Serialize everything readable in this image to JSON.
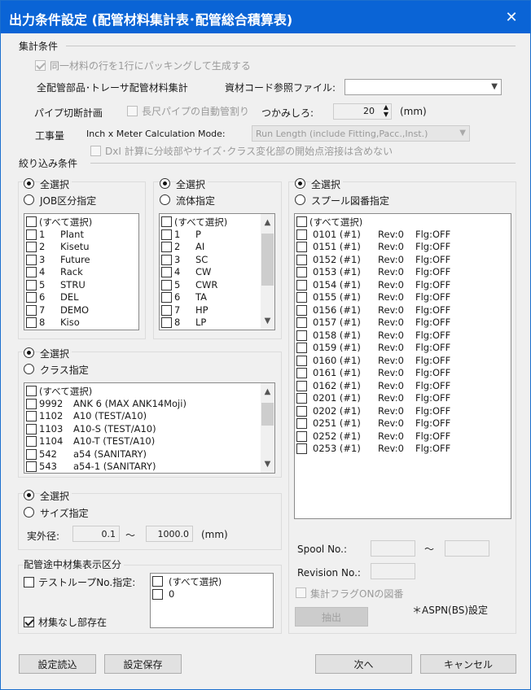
{
  "window": {
    "title": "出力条件設定 (配管材料集計表･配管総合積算表)",
    "close_glyph": "✕"
  },
  "aggregate": {
    "header": "集計条件",
    "same_material_label": "同一材料の行を1行にパッキングして生成する",
    "same_material_checked": true,
    "all_parts_label": "全配管部品･トレーサ配管材料集計",
    "material_code_file_label": "資材コード参照ファイル:",
    "material_code_file_value": "",
    "pipe_cut_label": "パイプ切断計画",
    "long_pipe_label": "長尺パイプの自動管割り",
    "long_pipe_checked": false,
    "grip_label": "つかみしろ:",
    "grip_value": "20",
    "grip_unit": "(mm)",
    "work_amount_label": "工事量",
    "calc_mode_label": "Inch x Meter Calculation Mode:",
    "calc_mode_value": "Run Length (include Fitting,Pacc.,Inst.)",
    "dxi_label": "DxI 計算に分岐部やサイズ･クラス変化部の開始点溶接は含めない",
    "dxi_checked": false
  },
  "filter": {
    "header": "絞り込み条件"
  },
  "job": {
    "all_label": "全選択",
    "specify_label": "JOB区分指定",
    "items": [
      {
        "no": "",
        "name": "(すべて選択)"
      },
      {
        "no": "1",
        "name": "Plant"
      },
      {
        "no": "2",
        "name": "Kisetu"
      },
      {
        "no": "3",
        "name": "Future"
      },
      {
        "no": "4",
        "name": "Rack"
      },
      {
        "no": "5",
        "name": "STRU"
      },
      {
        "no": "6",
        "name": "DEL"
      },
      {
        "no": "7",
        "name": "DEMO"
      },
      {
        "no": "8",
        "name": "Kiso"
      }
    ]
  },
  "fluid": {
    "all_label": "全選択",
    "specify_label": "流体指定",
    "items": [
      {
        "no": "",
        "name": "(すべて選択)"
      },
      {
        "no": "1",
        "name": "P"
      },
      {
        "no": "2",
        "name": "AI"
      },
      {
        "no": "3",
        "name": "SC"
      },
      {
        "no": "4",
        "name": "CW"
      },
      {
        "no": "5",
        "name": "CWR"
      },
      {
        "no": "6",
        "name": "TA"
      },
      {
        "no": "7",
        "name": "HP"
      },
      {
        "no": "8",
        "name": "LP"
      }
    ]
  },
  "spool": {
    "all_label": "全選択",
    "specify_label": "スプール図番指定",
    "select_all": "(すべて選択)",
    "items": [
      {
        "no": "0101 (#1)",
        "rev": "Rev:0",
        "flg": "Flg:OFF"
      },
      {
        "no": "0151 (#1)",
        "rev": "Rev:0",
        "flg": "Flg:OFF"
      },
      {
        "no": "0152 (#1)",
        "rev": "Rev:0",
        "flg": "Flg:OFF"
      },
      {
        "no": "0153 (#1)",
        "rev": "Rev:0",
        "flg": "Flg:OFF"
      },
      {
        "no": "0154 (#1)",
        "rev": "Rev:0",
        "flg": "Flg:OFF"
      },
      {
        "no": "0155 (#1)",
        "rev": "Rev:0",
        "flg": "Flg:OFF"
      },
      {
        "no": "0156 (#1)",
        "rev": "Rev:0",
        "flg": "Flg:OFF"
      },
      {
        "no": "0157 (#1)",
        "rev": "Rev:0",
        "flg": "Flg:OFF"
      },
      {
        "no": "0158 (#1)",
        "rev": "Rev:0",
        "flg": "Flg:OFF"
      },
      {
        "no": "0159 (#1)",
        "rev": "Rev:0",
        "flg": "Flg:OFF"
      },
      {
        "no": "0160 (#1)",
        "rev": "Rev:0",
        "flg": "Flg:OFF"
      },
      {
        "no": "0161 (#1)",
        "rev": "Rev:0",
        "flg": "Flg:OFF"
      },
      {
        "no": "0162 (#1)",
        "rev": "Rev:0",
        "flg": "Flg:OFF"
      },
      {
        "no": "0201 (#1)",
        "rev": "Rev:0",
        "flg": "Flg:OFF"
      },
      {
        "no": "0202 (#1)",
        "rev": "Rev:0",
        "flg": "Flg:OFF"
      },
      {
        "no": "0251 (#1)",
        "rev": "Rev:0",
        "flg": "Flg:OFF"
      },
      {
        "no": "0252 (#1)",
        "rev": "Rev:0",
        "flg": "Flg:OFF"
      },
      {
        "no": "0253 (#1)",
        "rev": "Rev:0",
        "flg": "Flg:OFF"
      }
    ],
    "spool_no_label": "Spool No.:",
    "tilde": "～",
    "revision_label": "Revision No.:",
    "flag_on_label": "集計フラグONの図番",
    "extract_button": "抽出",
    "aspn_note": "＊ASPN(BS)設定"
  },
  "class": {
    "all_label": "全選択",
    "specify_label": "クラス指定",
    "items": [
      {
        "no": "",
        "name": "(すべて選択)"
      },
      {
        "no": "9992",
        "name": "ANK 6 (MAX ANK14Moji)"
      },
      {
        "no": "1102",
        "name": "A10 (TEST/A10)"
      },
      {
        "no": "1103",
        "name": "A10-S (TEST/A10)"
      },
      {
        "no": "1104",
        "name": "A10-T (TEST/A10)"
      },
      {
        "no": "542",
        "name": "a54 (SANITARY)"
      },
      {
        "no": "543",
        "name": "a54-1 (SANITARY)"
      }
    ]
  },
  "size": {
    "all_label": "全選択",
    "specify_label": "サイズ指定",
    "od_label": "実外径:",
    "od_min": "0.1",
    "tilde": "～",
    "od_max": "1000.0",
    "unit": "(mm)"
  },
  "midpipe": {
    "header": "配管途中材集表示区分",
    "testloop_label": "テストループNo.指定:",
    "testloop_checked": false,
    "items": [
      "(すべて選択)",
      "0"
    ],
    "nomat_label": "材集なし部存在",
    "nomat_checked": true
  },
  "footer": {
    "load_button": "設定読込",
    "save_button": "設定保存",
    "next_button": "次へ",
    "cancel_button": "キャンセル"
  }
}
